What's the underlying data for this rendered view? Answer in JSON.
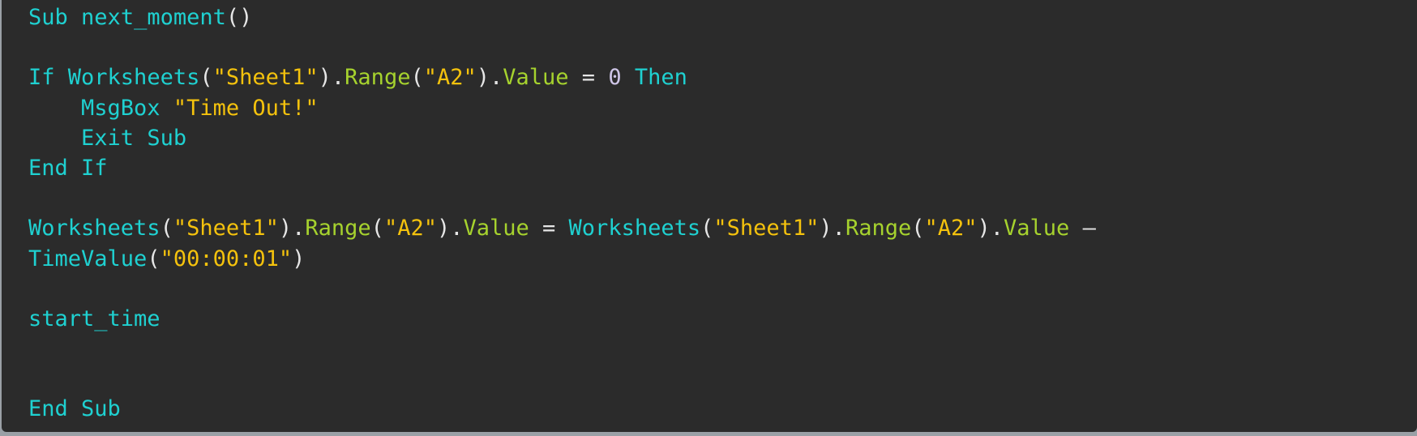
{
  "code_view": {
    "language": "VBA",
    "colors": {
      "background": "#2b2b2b",
      "keyword": "#1fd1d1",
      "string": "#f4c20d",
      "property": "#a6d22e",
      "number": "#cfc6e8",
      "punctuation": "#e6e6e6"
    },
    "lines": [
      [
        {
          "t": "Sub",
          "c": "keyword"
        },
        {
          "t": " ",
          "c": "plain"
        },
        {
          "t": "next_moment",
          "c": "function"
        },
        {
          "t": "()",
          "c": "punct"
        }
      ],
      [],
      [
        {
          "t": "If",
          "c": "keyword"
        },
        {
          "t": " ",
          "c": "plain"
        },
        {
          "t": "Worksheets",
          "c": "function"
        },
        {
          "t": "(",
          "c": "punct"
        },
        {
          "t": "\"Sheet1\"",
          "c": "string"
        },
        {
          "t": ").",
          "c": "punct"
        },
        {
          "t": "Range",
          "c": "property"
        },
        {
          "t": "(",
          "c": "punct"
        },
        {
          "t": "\"A2\"",
          "c": "string"
        },
        {
          "t": ").",
          "c": "punct"
        },
        {
          "t": "Value",
          "c": "property"
        },
        {
          "t": " = ",
          "c": "operator"
        },
        {
          "t": "0",
          "c": "number"
        },
        {
          "t": " ",
          "c": "plain"
        },
        {
          "t": "Then",
          "c": "keyword"
        }
      ],
      [
        {
          "t": "    ",
          "c": "plain"
        },
        {
          "t": "MsgBox",
          "c": "function"
        },
        {
          "t": " ",
          "c": "plain"
        },
        {
          "t": "\"Time Out!\"",
          "c": "string"
        }
      ],
      [
        {
          "t": "    ",
          "c": "plain"
        },
        {
          "t": "Exit",
          "c": "keyword"
        },
        {
          "t": " ",
          "c": "plain"
        },
        {
          "t": "Sub",
          "c": "keyword"
        }
      ],
      [
        {
          "t": "End",
          "c": "keyword"
        },
        {
          "t": " ",
          "c": "plain"
        },
        {
          "t": "If",
          "c": "keyword"
        }
      ],
      [],
      [
        {
          "t": "Worksheets",
          "c": "function"
        },
        {
          "t": "(",
          "c": "punct"
        },
        {
          "t": "\"Sheet1\"",
          "c": "string"
        },
        {
          "t": ").",
          "c": "punct"
        },
        {
          "t": "Range",
          "c": "property"
        },
        {
          "t": "(",
          "c": "punct"
        },
        {
          "t": "\"A2\"",
          "c": "string"
        },
        {
          "t": ").",
          "c": "punct"
        },
        {
          "t": "Value",
          "c": "property"
        },
        {
          "t": " = ",
          "c": "operator"
        },
        {
          "t": "Worksheets",
          "c": "function"
        },
        {
          "t": "(",
          "c": "punct"
        },
        {
          "t": "\"Sheet1\"",
          "c": "string"
        },
        {
          "t": ").",
          "c": "punct"
        },
        {
          "t": "Range",
          "c": "property"
        },
        {
          "t": "(",
          "c": "punct"
        },
        {
          "t": "\"A2\"",
          "c": "string"
        },
        {
          "t": ").",
          "c": "punct"
        },
        {
          "t": "Value",
          "c": "property"
        },
        {
          "t": " –",
          "c": "operator"
        }
      ],
      [
        {
          "t": "TimeValue",
          "c": "function"
        },
        {
          "t": "(",
          "c": "punct"
        },
        {
          "t": "\"00:00:01\"",
          "c": "string"
        },
        {
          "t": ")",
          "c": "punct"
        }
      ],
      [],
      [
        {
          "t": "start_time",
          "c": "identifier"
        }
      ],
      [],
      [],
      [
        {
          "t": "End",
          "c": "keyword"
        },
        {
          "t": " ",
          "c": "plain"
        },
        {
          "t": "Sub",
          "c": "keyword"
        }
      ]
    ]
  }
}
